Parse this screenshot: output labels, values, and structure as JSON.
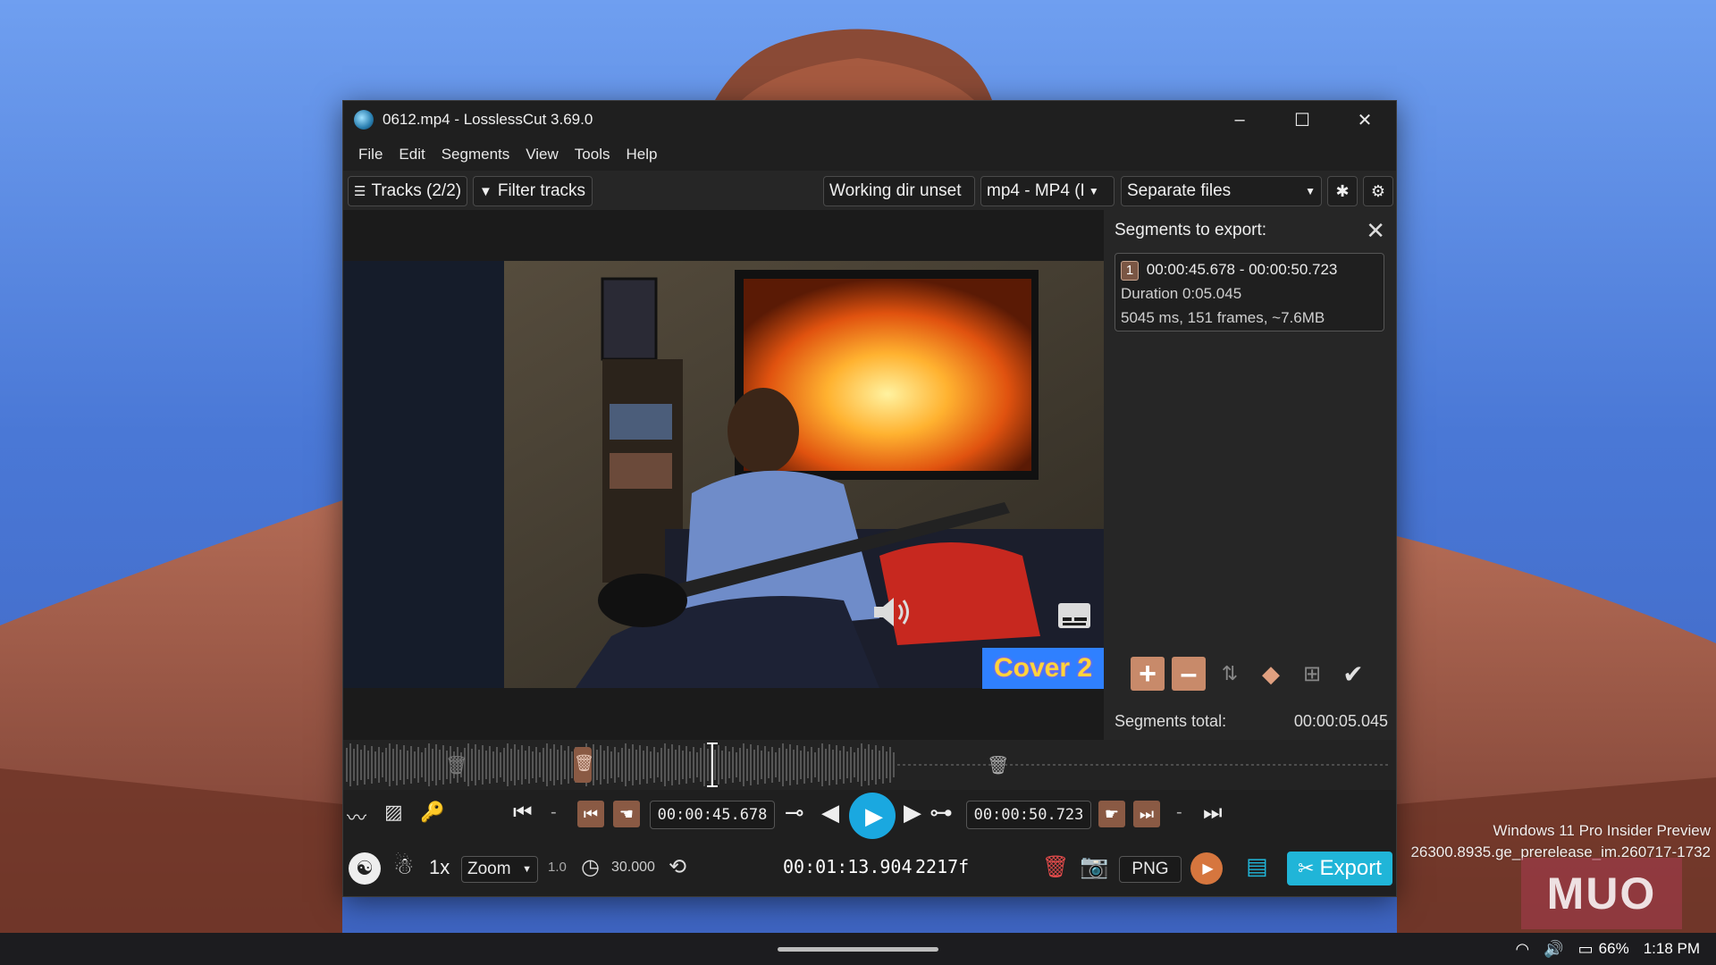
{
  "window": {
    "title": "0612.mp4 - LosslessCut 3.69.0",
    "controls": {
      "minimize": "–",
      "maximize": "☐",
      "close": "✕"
    }
  },
  "menu": [
    "File",
    "Edit",
    "Segments",
    "View",
    "Tools",
    "Help"
  ],
  "toolbar": {
    "tracks": "Tracks (2/2)",
    "filter": "Filter tracks",
    "working_dir": "Working dir unset",
    "format": "mp4 - MP4 (I",
    "output_mode": "Separate files"
  },
  "video": {
    "overlay_label": "Cover 2"
  },
  "segments_panel": {
    "title": "Segments to export:",
    "segments": [
      {
        "index": "1",
        "range": "00:00:45.678 - 00:00:50.723",
        "duration": "Duration 0:05.045",
        "info": "5045 ms, 151 frames, ~7.6MB"
      }
    ],
    "total_label": "Segments total:",
    "total_value": "00:00:05.045"
  },
  "controls": {
    "start_time": "00:00:45.678",
    "end_time": "00:00:50.723",
    "dash": "-",
    "speed": "1x",
    "zoom_label": "Zoom",
    "zoom_value": "1.0",
    "fps": "30.000",
    "current_time": "00:01:13.904",
    "frame": "2217f",
    "capture_format": "PNG",
    "export": "Export"
  },
  "watermark": {
    "line1": "Windows 11 Pro Insider Preview",
    "line2": "26300.8935.ge_prerelease_im.260717-1732",
    "logo": "MUO"
  },
  "taskbar": {
    "battery": "66%",
    "time": "1:18 PM"
  },
  "colors": {
    "accent": "#20b5d8",
    "play": "#1aa8e0",
    "segment": "#8a5a44"
  }
}
